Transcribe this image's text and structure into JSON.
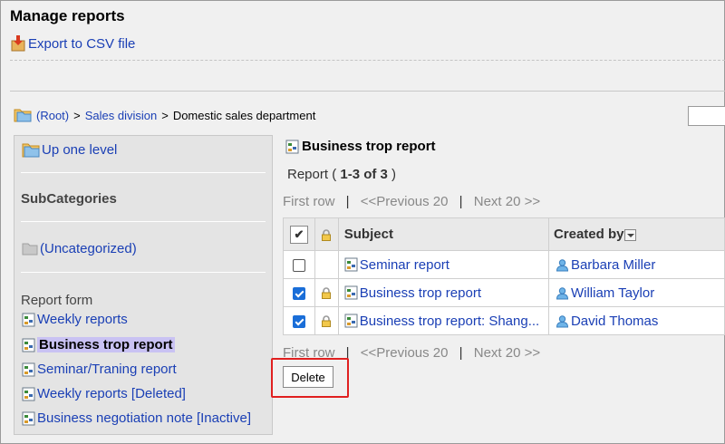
{
  "header": {
    "title": "Manage reports",
    "export_label": "Export to CSV file"
  },
  "breadcrumb": {
    "root": "(Root)",
    "separator": ">",
    "level1": "Sales division",
    "current": "Domestic sales department"
  },
  "sidebar": {
    "up_one_level": "Up one level",
    "subcategories_heading": "SubCategories",
    "uncategorized": "(Uncategorized)",
    "report_form_heading": "Report form",
    "forms": [
      {
        "label": "Weekly reports"
      },
      {
        "label": "Business trop report",
        "selected": true
      },
      {
        "label": "Seminar/Traning report"
      },
      {
        "label": "Weekly reports [Deleted]"
      },
      {
        "label": "Business negotiation note [Inactive]"
      }
    ]
  },
  "main": {
    "title": "Business trop report",
    "count_prefix": "Report ( ",
    "count_range": "1-3 of 3",
    "count_suffix": " )",
    "pager": {
      "first": "First row",
      "prev": "<<Previous 20",
      "next": "Next 20 >>",
      "pipe": "|"
    },
    "table": {
      "headers": {
        "check": "✔",
        "subject": "Subject",
        "created_by": "Created by"
      },
      "rows": [
        {
          "checked": false,
          "locked": false,
          "subject": "Seminar report",
          "creator": "Barbara Miller"
        },
        {
          "checked": true,
          "locked": true,
          "subject": "Business trop report",
          "creator": "William Taylor"
        },
        {
          "checked": true,
          "locked": true,
          "subject": "Business trop report: Shang...",
          "creator": "David Thomas"
        }
      ]
    },
    "delete_label": "Delete"
  },
  "colors": {
    "link": "#1a3fb5",
    "highlight_border": "#e02020",
    "selected_bg": "#c9c2f3"
  }
}
